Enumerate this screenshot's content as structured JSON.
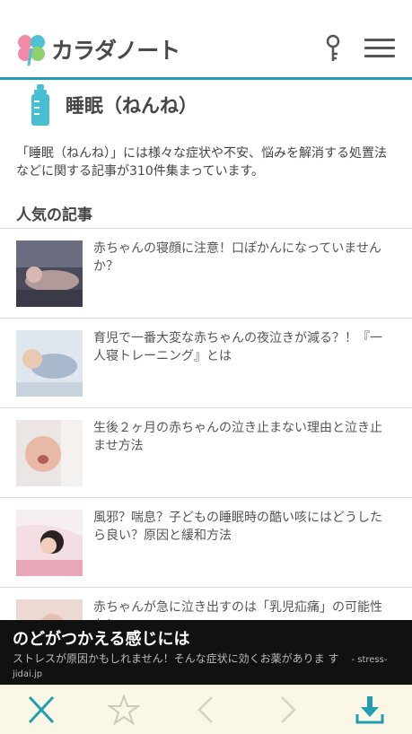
{
  "header": {
    "logo_text": "カラダノート",
    "icons": [
      "clover-logo-icon",
      "key-icon",
      "hamburger-menu-icon"
    ],
    "accent_color": "#1f9fb1"
  },
  "category": {
    "title": "睡眠（ねんね）",
    "icon": "baby-bottle-icon",
    "description": "「睡眠（ねんね）」には様々な症状や不安、悩みを解消する処置法などに関する記事が310件集まっています。"
  },
  "popular": {
    "heading": "人気の記事",
    "articles": [
      {
        "title": "赤ちゃんの寝顔に注意！口ぽかんになっていませんか？"
      },
      {
        "title": "育児で一番大変な赤ちゃんの夜泣きが減る？！『一人寝トレーニング』とは"
      },
      {
        "title": "生後２ヶ月の赤ちゃんの泣き止まない理由と泣き止ませ方法"
      },
      {
        "title": "風邪？喘息？子どもの睡眠時の酷い咳にはどうしたら良い？原因と緩和方法"
      },
      {
        "title": "赤ちゃんが急に泣き出すのは「乳児疝痛」の可能性も！"
      }
    ]
  },
  "ad": {
    "title": "のどがつかえる感じには",
    "body": "ストレスが原因かもしれません！そんな症状に効くお薬がありま す",
    "source": "- stress-jidai.jp"
  },
  "toolbar": {
    "items": [
      "close-icon",
      "star-icon",
      "back-arrow-icon",
      "forward-arrow-icon",
      "download-icon"
    ],
    "accent_color": "#1f9fb1"
  }
}
